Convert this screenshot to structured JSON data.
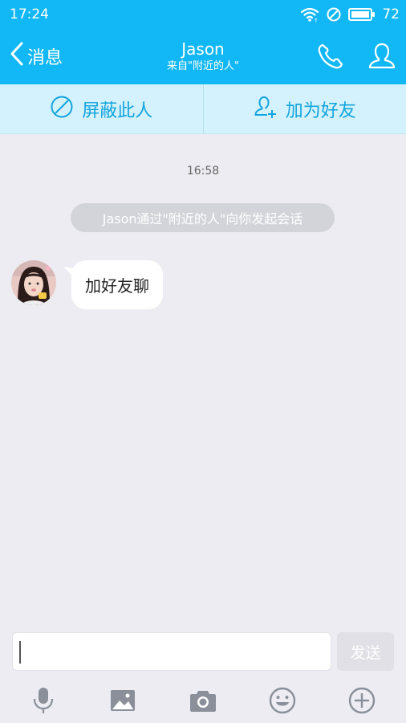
{
  "status_bar": {
    "time": "17:24",
    "battery": "72",
    "icons": [
      "wifi-icon",
      "no-sim-icon",
      "battery-icon"
    ]
  },
  "header": {
    "back_label": "消息",
    "title": "Jason",
    "subtitle": "来自\"附近的人\"",
    "icons": [
      "phone-icon",
      "profile-icon"
    ]
  },
  "actions": {
    "block_label": "屏蔽此人",
    "add_friend_label": "加为好友"
  },
  "chat": {
    "timestamp": "16:58",
    "system_message": "Jason通过\"附近的人\"向你发起会话",
    "messages": [
      {
        "text": "加好友聊"
      }
    ]
  },
  "composer": {
    "input_value": "",
    "send_label": "发送"
  },
  "toolbar": {
    "icons": [
      "microphone-icon",
      "image-icon",
      "camera-icon",
      "emoji-icon",
      "plus-icon"
    ]
  },
  "colors": {
    "brand": "#12b7f5",
    "action_bar_bg": "#d4f2fd",
    "action_text": "#12a4dd",
    "chat_bg": "#ececf2",
    "toolbar_icon": "#8a8f99"
  }
}
